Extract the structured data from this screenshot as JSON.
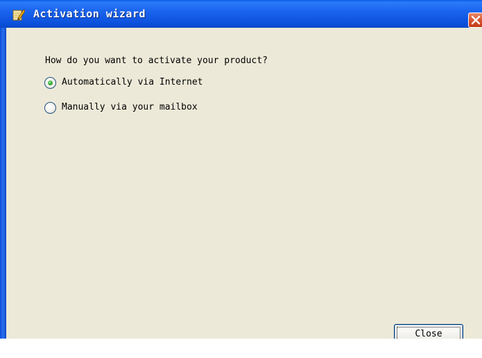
{
  "window": {
    "title": "Activation wizard",
    "title_icon": "pencil-notepad-icon",
    "close_icon": "close-x-icon"
  },
  "dialog": {
    "question": "How do you want to activate your product?",
    "options": [
      {
        "label": "Automatically via Internet",
        "selected": true
      },
      {
        "label": "Manually via your mailbox",
        "selected": false
      }
    ],
    "close_button_label": "Close"
  },
  "colors": {
    "titlebar": "#0a5be8",
    "body_background": "#ece9d8",
    "radio_selected": "#2ea42e",
    "button_border": "#003c74"
  }
}
